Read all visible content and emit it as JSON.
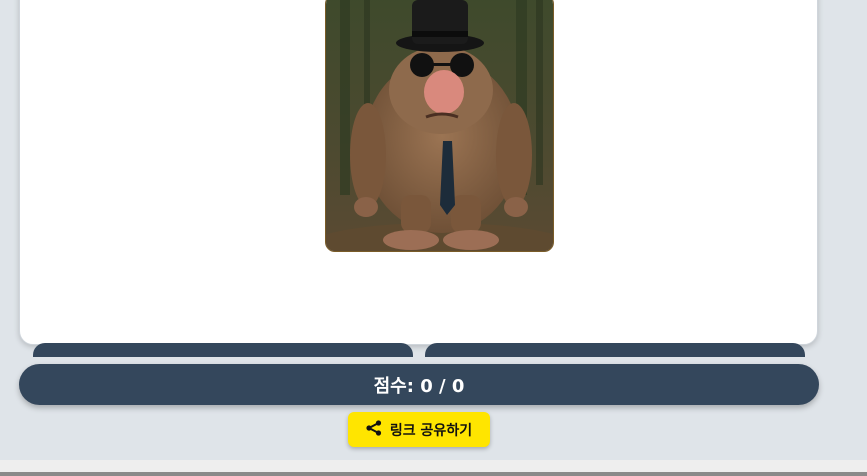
{
  "score": {
    "label": "점수: 0 / 0"
  },
  "share": {
    "label": "링크 공유하기",
    "icon": "share-icon"
  },
  "image": {
    "subject": "furry-creature-with-top-hat-portrait"
  },
  "colors": {
    "card_bg": "#ffffff",
    "page_bg": "#dfe4e9",
    "bar": "#34475c",
    "share_button": "#ffe500"
  }
}
